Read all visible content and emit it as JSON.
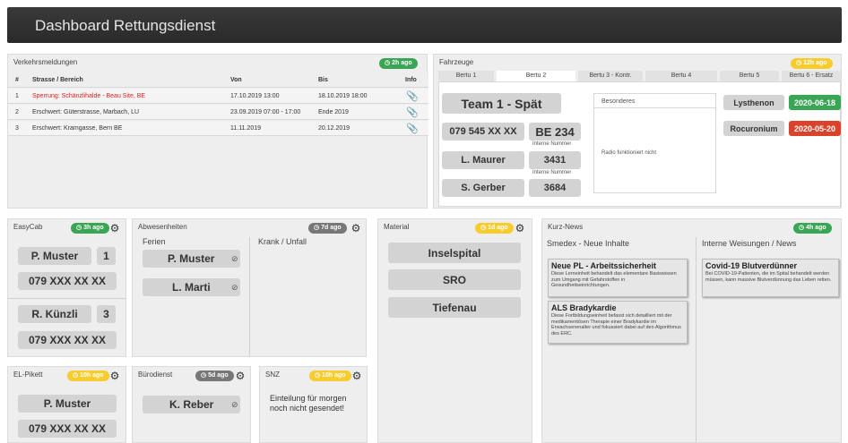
{
  "header": {
    "title": "Dashboard Rettungsdienst"
  },
  "traffic": {
    "title": "Verkehrsmeldungen",
    "badge": "2h ago",
    "columns": [
      "#",
      "Strasse / Bereich",
      "Von",
      "Bis",
      "Info"
    ],
    "rows": [
      {
        "n": "1",
        "street": "Sperrung: Schänzlihalde - Beau Site, BE",
        "from": "17.10.2019 13:00",
        "to": "18.10.2019 18:00"
      },
      {
        "n": "2",
        "street": "Erschwert: Güterstrasse, Marbach, LU",
        "from": "23.09.2019 07:00 - 17:00",
        "to": "Ende 2019"
      },
      {
        "n": "3",
        "street": "Erschwert: Kramgasse, Bern BE",
        "from": "11.11.2019",
        "to": "20.12.2019"
      }
    ]
  },
  "vehicles": {
    "title": "Fahrzeuge",
    "badge": "12h ago",
    "tabs": [
      "Bertu 1",
      "Bertu 2",
      "Bertu 3 - Kontr.",
      "Bertu 4",
      "Bertu 5",
      "Bertu 6 - Ersatz"
    ],
    "team": "Team 1 - Spät",
    "phone": "079 545 XX XX",
    "plate": "BE 234",
    "intern_label": "Interne Nummer",
    "person1": "L. Maurer",
    "num1": "3431",
    "person2": "S. Gerber",
    "num2": "3684",
    "special_title": "Besonderes",
    "special_text": "Radio funktioniert nicht",
    "med1": "Lysthenon",
    "date1": "2020-06-18",
    "med2": "Rocuronium",
    "date2": "2020-05-20"
  },
  "easycab": {
    "title": "EasyCab",
    "badge": "3h ago",
    "p1": "P. Muster",
    "n1": "1",
    "phone1": "079 XXX XX XX",
    "p2": "R. Künzli",
    "n2": "3",
    "phone2": "079 XXX XX XX"
  },
  "absences": {
    "title": "Abwesenheiten",
    "badge": "7d ago",
    "col1": "Ferien",
    "col2": "Krank / Unfall",
    "p1": "P. Muster",
    "p2": "L. Marti"
  },
  "material": {
    "title": "Material",
    "badge": "1d ago",
    "items": [
      "Inselspital",
      "SRO",
      "Tiefenau"
    ]
  },
  "news": {
    "title": "Kurz-News",
    "badge": "4h ago",
    "col1": "Smedex - Neue Inhalte",
    "col2": "Interne Weisungen / News",
    "items": [
      {
        "title": "Neue PL - Arbeitssicherheit",
        "body": "Diese Lerneinheit behandelt das elementare Basiswissen zum Umgang mit Gefahrstoffen in Gesundheitseinrichtungen."
      },
      {
        "title": "ALS Bradykardie",
        "body": "Diese Fortbildungseinheit befasst sich detailliert mit der medikamentösen Therapie einer Bradykardie im Erwachsenenalter und fokussiert dabei auf den Algorithmus des ERC."
      },
      {
        "title": "Covid-19 Blutverdünner",
        "body": "Bei COVID-19-Patienten, die im Spital behandelt werden müssen, kann massive Blutverdünnung das Leben retten."
      }
    ]
  },
  "elpikett": {
    "title": "EL-Pikett",
    "badge": "10h ago",
    "p1": "P. Muster",
    "phone1": "079 XXX XX XX"
  },
  "buero": {
    "title": "Bürodienst",
    "badge": "5d ago",
    "p1": "K. Reber"
  },
  "snz": {
    "title": "SNZ",
    "badge": "10h ago",
    "text": "Einteilung für morgen noch nicht gesendet!"
  },
  "colors": {
    "green": "#3aa655",
    "yellow": "#f7cc2f",
    "red": "#d9432b",
    "gray": "#777777"
  },
  "icons": {
    "gear": "gear-icon",
    "clip": "paperclip-icon",
    "remove": "remove-icon",
    "clock": "clock-icon"
  }
}
